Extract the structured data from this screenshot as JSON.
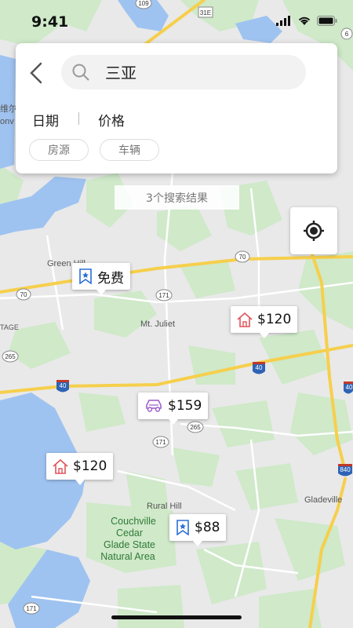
{
  "status_bar": {
    "time": "9:41"
  },
  "search": {
    "back_label": "<",
    "query": "三亚"
  },
  "filters": {
    "date": "日期",
    "price": "价格"
  },
  "chips": [
    {
      "label": "房源"
    },
    {
      "label": "车辆"
    }
  ],
  "results_text": "3个搜索结果",
  "map_labels": {
    "green_hill": "Green Hill",
    "mt_juliet": "Mt. Juliet",
    "rural_hill": "Rural Hill",
    "gladeville": "Gladeville",
    "couchville_1": "Couchville",
    "couchville_2": "Cedar",
    "couchville_3": "Glade State",
    "couchville_4": "Natural Area",
    "edge_1": "维尔",
    "edge_2": "onv",
    "tage": "TAGE",
    "r70a": "70",
    "r70b": "70",
    "r171a": "171",
    "r171b": "171",
    "r171c": "171",
    "r265a": "265",
    "r265b": "265",
    "r40a": "40",
    "r40b": "40",
    "r40c": "40",
    "r840": "840",
    "r31e": "31E",
    "r109": "109",
    "r6": "6"
  },
  "pins": [
    {
      "id": "free",
      "icon": "bookmark-star-icon",
      "label": "免费",
      "color": "#2b6fd6"
    },
    {
      "id": "house1",
      "icon": "house-icon",
      "label": "$120",
      "color": "#e0555a"
    },
    {
      "id": "car",
      "icon": "car-icon",
      "label": "$159",
      "color": "#9b59c9"
    },
    {
      "id": "house2",
      "icon": "house-icon",
      "label": "$120",
      "color": "#e0555a"
    },
    {
      "id": "bookmark2",
      "icon": "bookmark-star-icon",
      "label": "$88",
      "color": "#2b6fd6"
    }
  ],
  "colors": {
    "water": "#9fc3f0",
    "land": "#e9e9e9",
    "park": "#cfe9c9",
    "road": "#f6cf4c"
  }
}
